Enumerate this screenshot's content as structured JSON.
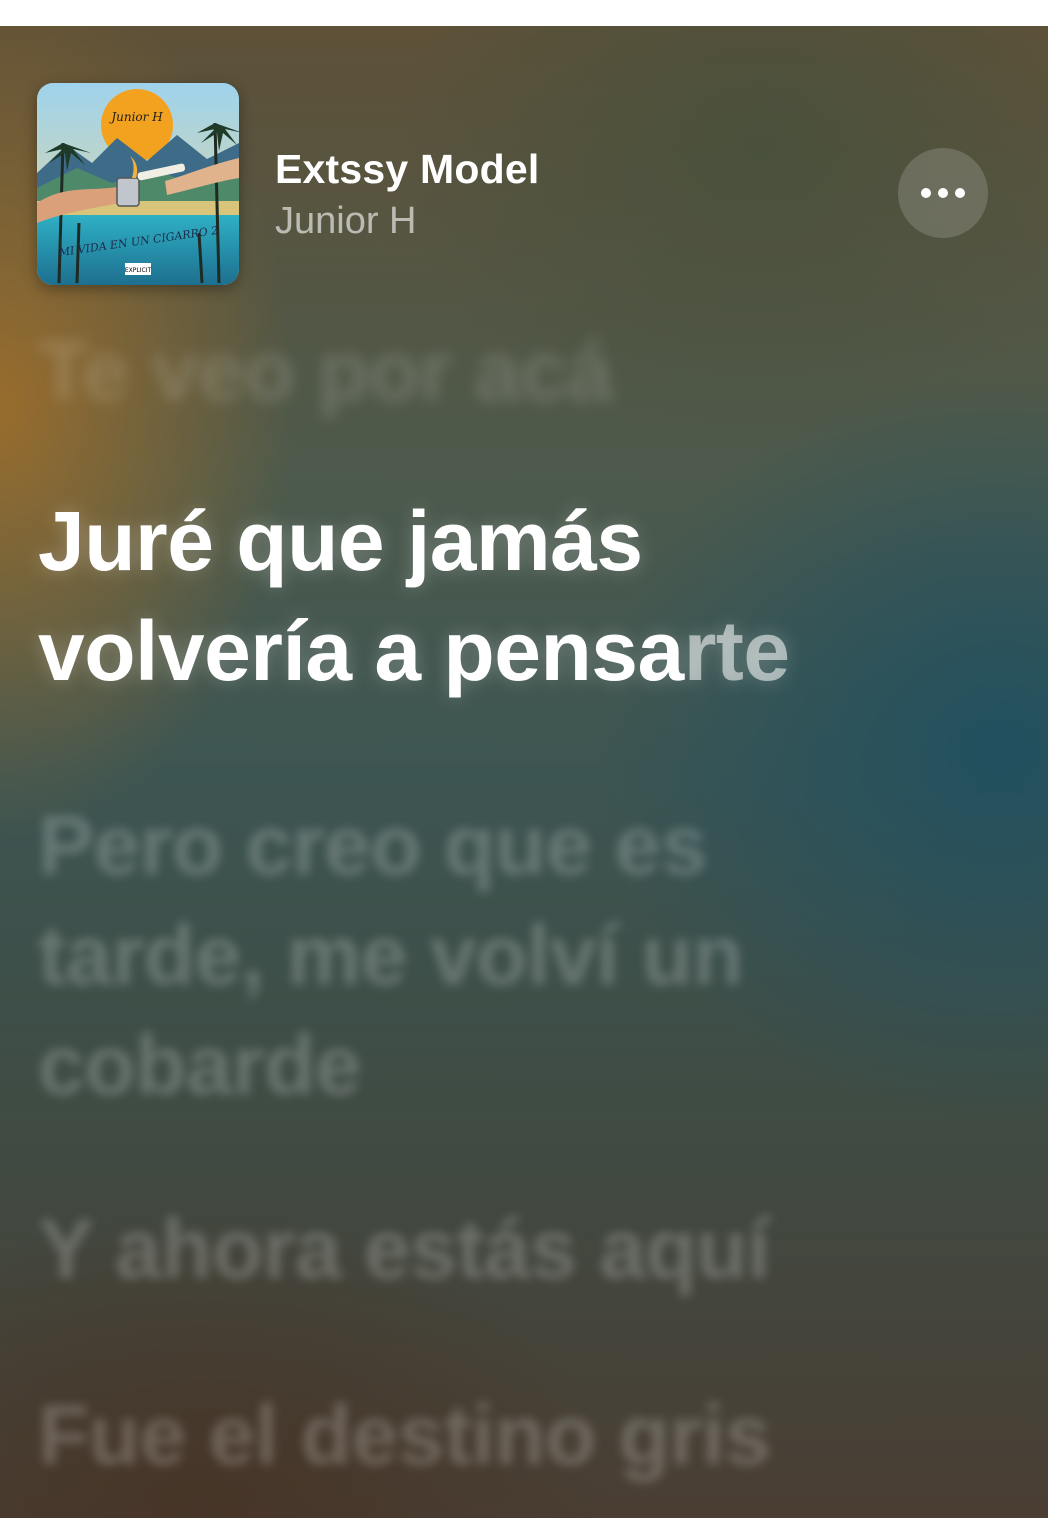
{
  "header": {
    "song_title": "Extssy Model",
    "artist": "Junior H",
    "album_art": {
      "text_top": "Junior H",
      "text_bottom": "MI VIDA EN UN CIGARRO 2",
      "advisory_label": "EXPLICIT"
    },
    "more_button_icon": "ellipsis-icon"
  },
  "lyrics": {
    "previous_line": "Te veo por acá",
    "current_line_1": "Juré que jamás",
    "current_line_2_sung": "volvería a pensa",
    "current_line_2_unsung": "rte",
    "next_line_1": "Pero creo que es",
    "next_line_2": "tarde, me volví un",
    "next_line_3": "cobarde",
    "following_line": "Y ahora estás aquí",
    "last_line": "Fue el destino gris"
  },
  "colors": {
    "accent_warm": "#a57028",
    "accent_teal": "#205060",
    "text_primary": "#ffffff"
  }
}
